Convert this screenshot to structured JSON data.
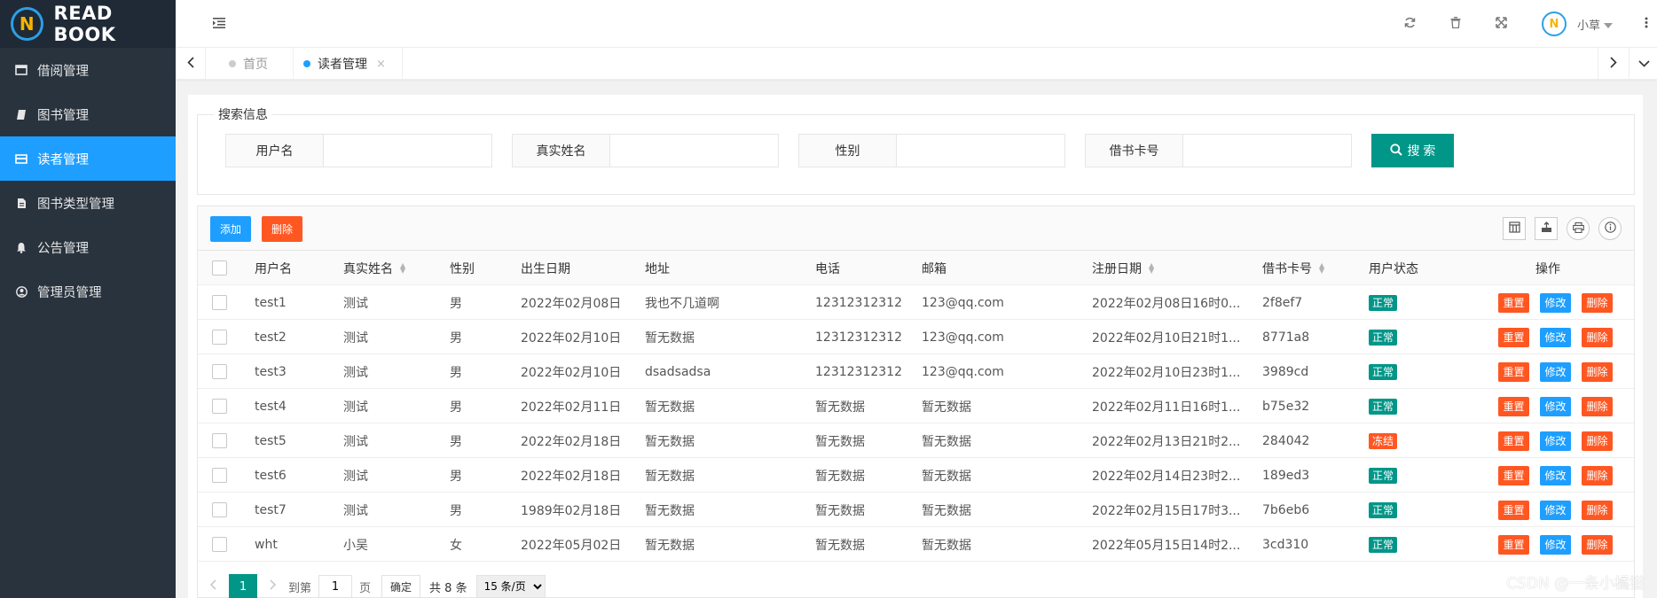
{
  "app": {
    "logo_text": "READ BOOK",
    "logo_letter": "N"
  },
  "colors": {
    "sidebar": "#28333e",
    "active": "#1e9fff",
    "primary": "#009688",
    "danger": "#ff5722",
    "info": "#1e9fff"
  },
  "sidebar": {
    "items": [
      {
        "label": "借阅管理",
        "icon": "window-icon"
      },
      {
        "label": "图书管理",
        "icon": "book-icon"
      },
      {
        "label": "读者管理",
        "icon": "card-icon"
      },
      {
        "label": "图书类型管理",
        "icon": "file-icon"
      },
      {
        "label": "公告管理",
        "icon": "bell-icon"
      },
      {
        "label": "管理员管理",
        "icon": "user-circle-icon"
      }
    ]
  },
  "header": {
    "user_name": "小草"
  },
  "tabs": [
    {
      "label": "首页"
    },
    {
      "label": "读者管理"
    }
  ],
  "search": {
    "legend": "搜索信息",
    "fields": [
      {
        "label": "用户名",
        "value": ""
      },
      {
        "label": "真实姓名",
        "value": ""
      },
      {
        "label": "性别",
        "value": ""
      },
      {
        "label": "借书卡号",
        "value": ""
      }
    ],
    "button": "搜 索"
  },
  "toolbar": {
    "add": "添加",
    "delete": "删除"
  },
  "table": {
    "headers": [
      "用户名",
      "真实姓名",
      "性别",
      "出生日期",
      "地址",
      "电话",
      "邮箱",
      "注册日期",
      "借书卡号",
      "用户状态",
      "操作"
    ],
    "rows": [
      {
        "username": "test1",
        "realname": "测试",
        "gender": "男",
        "birth": "2022年02月08日",
        "address": "我也不几道啊",
        "phone": "12312312312",
        "email": "123@qq.com",
        "reg": "2022年02月08日16时0...",
        "card": "2f8ef7",
        "status": "正常",
        "status_color": "#009688"
      },
      {
        "username": "test2",
        "realname": "测试",
        "gender": "男",
        "birth": "2022年02月10日",
        "address": "暂无数据",
        "phone": "12312312312",
        "email": "123@qq.com",
        "reg": "2022年02月10日21时1...",
        "card": "8771a8",
        "status": "正常",
        "status_color": "#009688"
      },
      {
        "username": "test3",
        "realname": "测试",
        "gender": "男",
        "birth": "2022年02月10日",
        "address": "dsadsadsa",
        "phone": "12312312312",
        "email": "123@qq.com",
        "reg": "2022年02月10日23时1...",
        "card": "3989cd",
        "status": "正常",
        "status_color": "#009688"
      },
      {
        "username": "test4",
        "realname": "测试",
        "gender": "男",
        "birth": "2022年02月11日",
        "address": "暂无数据",
        "phone": "暂无数据",
        "email": "暂无数据",
        "reg": "2022年02月11日16时1...",
        "card": "b75e32",
        "status": "正常",
        "status_color": "#009688"
      },
      {
        "username": "test5",
        "realname": "测试",
        "gender": "男",
        "birth": "2022年02月18日",
        "address": "暂无数据",
        "phone": "暂无数据",
        "email": "暂无数据",
        "reg": "2022年02月13日21时2...",
        "card": "284042",
        "status": "冻结",
        "status_color": "#ff5722"
      },
      {
        "username": "test6",
        "realname": "测试",
        "gender": "男",
        "birth": "2022年02月18日",
        "address": "暂无数据",
        "phone": "暂无数据",
        "email": "暂无数据",
        "reg": "2022年02月14日23时2...",
        "card": "189ed3",
        "status": "正常",
        "status_color": "#009688"
      },
      {
        "username": "test7",
        "realname": "测试",
        "gender": "男",
        "birth": "1989年02月18日",
        "address": "暂无数据",
        "phone": "暂无数据",
        "email": "暂无数据",
        "reg": "2022年02月15日17时3...",
        "card": "7b6eb6",
        "status": "正常",
        "status_color": "#009688"
      },
      {
        "username": "wht",
        "realname": "小吴",
        "gender": "女",
        "birth": "2022年05月02日",
        "address": "暂无数据",
        "phone": "暂无数据",
        "email": "暂无数据",
        "reg": "2022年05月15日14时2...",
        "card": "3cd310",
        "status": "正常",
        "status_color": "#009688"
      }
    ],
    "actions": {
      "reset": "重置",
      "edit": "修改",
      "delete": "删除"
    }
  },
  "pager": {
    "current": "1",
    "goto_label": "到第",
    "page_input": "1",
    "page_suffix": "页",
    "confirm": "确定",
    "total": "共 8 条",
    "page_size": "15 条/页"
  },
  "watermark": "CSDN @一条小橘猫"
}
